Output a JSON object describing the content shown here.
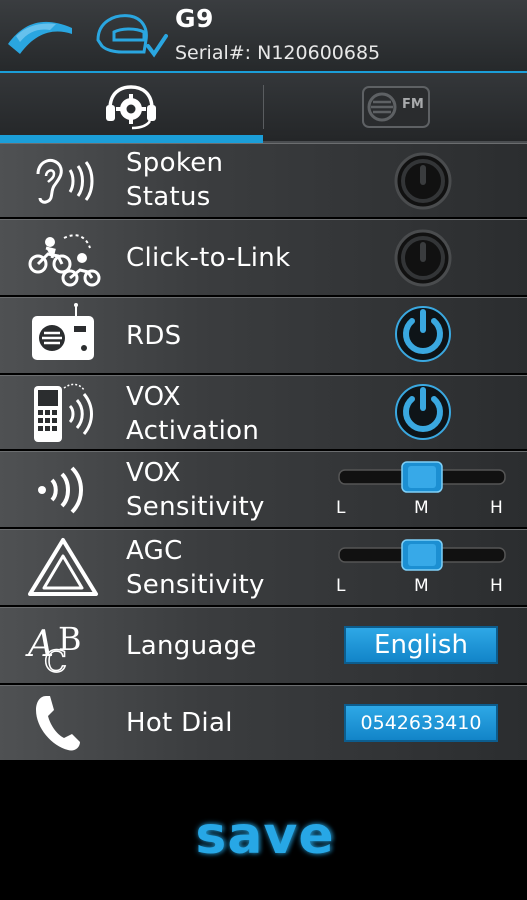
{
  "header": {
    "device_name": "G9",
    "serial": "Serial#: N120600685"
  },
  "tabs": [
    {
      "icon": "headset-gear-icon",
      "selected": true
    },
    {
      "icon": "fm-radio-icon",
      "label": "FM",
      "selected": false
    }
  ],
  "settings": {
    "spoken_status": {
      "label_1": "Spoken",
      "label_2": "Status",
      "state": "off"
    },
    "click_to_link": {
      "label": "Click-to-Link",
      "state": "off"
    },
    "rds": {
      "label": "RDS",
      "state": "on"
    },
    "vox_activation": {
      "label_1": "VOX",
      "label_2": "Activation",
      "state": "on"
    },
    "vox_sensitivity": {
      "label_1": "VOX",
      "label_2": "Sensitivity",
      "value": "M",
      "ticks": [
        "L",
        "M",
        "H"
      ]
    },
    "agc_sensitivity": {
      "label_1": "AGC",
      "label_2": "Sensitivity",
      "value": "M",
      "ticks": [
        "L",
        "M",
        "H"
      ]
    },
    "language": {
      "label": "Language",
      "value": "English"
    },
    "hot_dial": {
      "label": "Hot Dial",
      "value": "0542633410"
    }
  },
  "save_label": "save",
  "colors": {
    "accent": "#1b9ed8",
    "power_on": "#3aa8e0",
    "power_off": "#1a1a1a"
  }
}
